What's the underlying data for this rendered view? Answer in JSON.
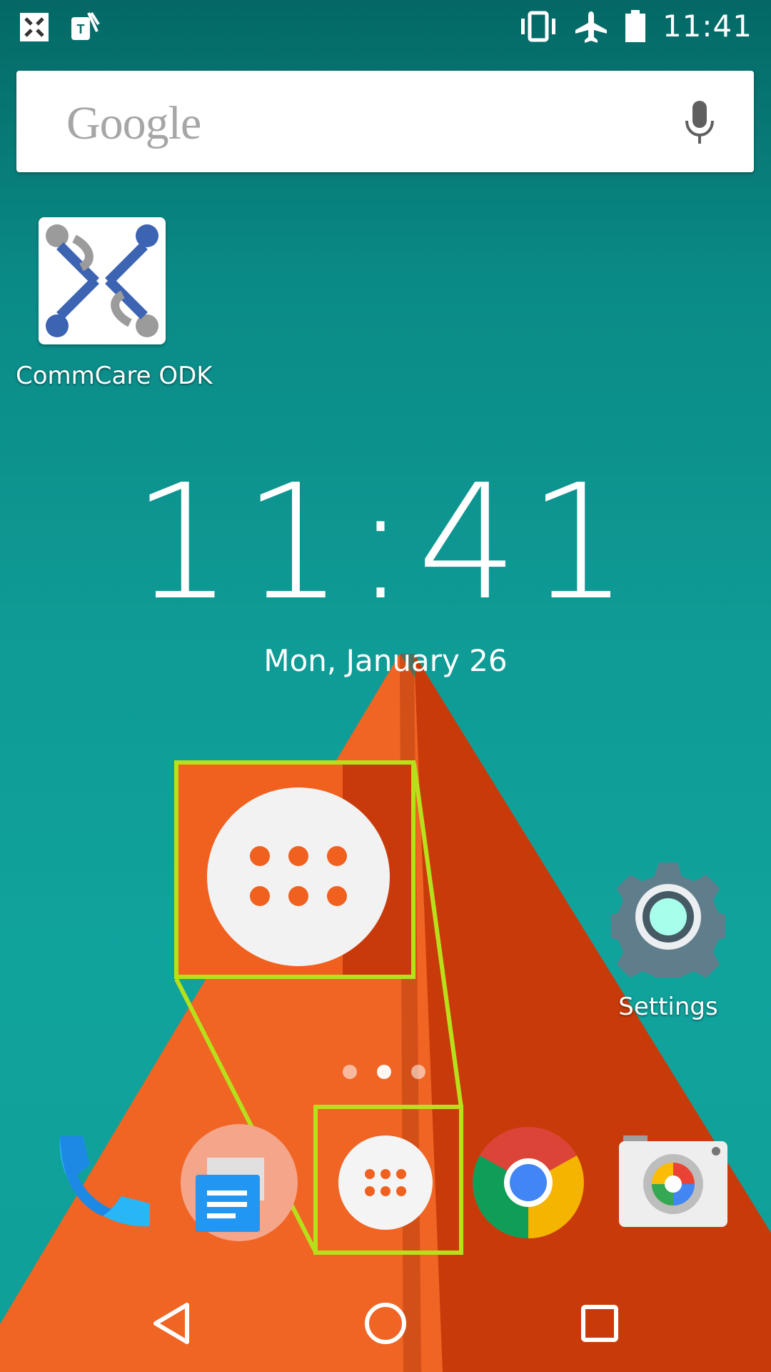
{
  "status_bar": {
    "time": "11:41",
    "left_icons": [
      "commcare-notification-icon",
      "tmobile-sim-icon"
    ],
    "right_icons": [
      "vibrate-icon",
      "airplane-mode-icon",
      "battery-icon"
    ]
  },
  "search": {
    "logo_text": "Google",
    "mic_icon": "mic-icon"
  },
  "home_apps": [
    {
      "label": "CommCare ODK",
      "icon": "commcare-app-icon"
    },
    {
      "label": "Settings",
      "icon": "settings-gear-icon"
    }
  ],
  "clock_widget": {
    "time": "11:41",
    "date": "Mon, January 26"
  },
  "page_indicator": {
    "pages": 3,
    "active_page": 2
  },
  "dock": [
    {
      "name": "Phone",
      "icon": "phone-icon"
    },
    {
      "name": "Messaging",
      "icon": "messaging-icon"
    },
    {
      "name": "App drawer",
      "icon": "app-drawer-icon"
    },
    {
      "name": "Chrome",
      "icon": "chrome-icon"
    },
    {
      "name": "Camera",
      "icon": "camera-icon"
    }
  ],
  "navigation": [
    "back-icon",
    "home-icon",
    "recents-icon"
  ],
  "colors": {
    "teal": "#0f9a95",
    "orange": "#f0601f",
    "highlight": "#b8e01a",
    "white": "#ffffff"
  }
}
